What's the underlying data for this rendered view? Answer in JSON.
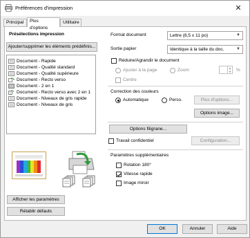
{
  "window": {
    "title": "Préférences d'impression",
    "close_glyph": "✕"
  },
  "tabs": [
    {
      "label": "Principal"
    },
    {
      "label": "Plus d'options"
    },
    {
      "label": "Utilitaire"
    }
  ],
  "presets": {
    "heading": "Présélections impression",
    "add_remove_button": "Ajouter/supprimer les éléments prédéfinis...",
    "items": [
      {
        "label": "Document - Rapide",
        "icon": "document-preset-icon"
      },
      {
        "label": "Document - Qualité standard",
        "icon": "document-preset-icon"
      },
      {
        "label": "Document - Qualité supérieure",
        "icon": "document-preset-icon"
      },
      {
        "label": "Document - Recto verso",
        "icon": "duplex-preset-icon"
      },
      {
        "label": "Document - 2 en 1",
        "icon": "two-up-preset-icon"
      },
      {
        "label": "Document - Recto verso avec 2 en 1",
        "icon": "duplex-two-up-preset-icon"
      },
      {
        "label": "Document - Niveaux de gris rapide",
        "icon": "document-preset-icon"
      },
      {
        "label": "Document - Niveaux de gris",
        "icon": "document-preset-icon"
      }
    ]
  },
  "buttons": {
    "show_settings": "Afficher les paramètres",
    "restore_defaults": "Rétablir défauts",
    "more_options": "Plus d'options...",
    "image_options": "Options image...",
    "watermark_options": "Options filigrane...",
    "configuration": "Configuration...",
    "ok": "OK",
    "cancel": "Annuler",
    "help": "Aide"
  },
  "format": {
    "document_label": "Format document",
    "document_value": "Lettre (8,5 x 11 po)",
    "output_label": "Sortie papier",
    "output_value": "Identique à la taille du doc."
  },
  "reduce_enlarge": {
    "label": "Réduire/Agrandir le document",
    "fit_page": "Ajuster à la page",
    "zoom": "Zoom",
    "percent": "%",
    "center": "Centre"
  },
  "color_correction": {
    "heading": "Correction des couleurs",
    "automatic": "Automatique",
    "custom": "Perso."
  },
  "confidential_job": "Travail confidentiel",
  "extra_settings": {
    "heading": "Paramètres supplémentaires",
    "rotate": "Rotation 180°",
    "high_speed": "Vitesse rapide",
    "mirror": "Image miroir",
    "rotate_checked": false,
    "high_speed_checked": true,
    "mirror_checked": false
  },
  "colors": {
    "accent": "#0078d7",
    "preview_border": "#c7a050",
    "printer_green": "#2f9a3a"
  }
}
